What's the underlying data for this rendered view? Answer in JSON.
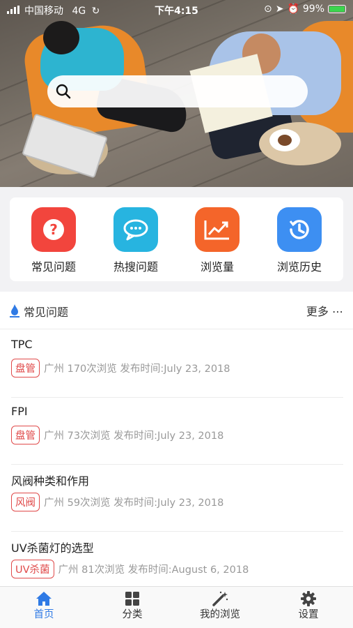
{
  "status_bar": {
    "carrier": "中国移动",
    "network": "4G",
    "time": "下午4:15",
    "battery": "99%",
    "battery_level": 0.99
  },
  "search": {
    "placeholder": ""
  },
  "quick_links": [
    {
      "label": "常见问题",
      "color": "#f2453d",
      "icon": "question-icon"
    },
    {
      "label": "热搜问题",
      "color": "#27b4e0",
      "icon": "chat-bubbles-icon"
    },
    {
      "label": "浏览量",
      "color": "#f4652a",
      "icon": "trend-chart-icon"
    },
    {
      "label": "浏览历史",
      "color": "#3d8ff2",
      "icon": "history-icon"
    }
  ],
  "section": {
    "title": "常见问题",
    "more": "更多 ⋯"
  },
  "articles": [
    {
      "title": "TPC",
      "tag": "盘管",
      "meta": "广州 170次浏览 发布时间:July 23, 2018"
    },
    {
      "title": "FPI",
      "tag": "盘管",
      "meta": "广州 73次浏览 发布时间:July 23, 2018"
    },
    {
      "title": "风阀种类和作用",
      "tag": "风阀",
      "meta": "广州 59次浏览 发布时间:July 23, 2018"
    },
    {
      "title": "UV杀菌灯的选型",
      "tag": "UV杀菌",
      "meta": "广州 81次浏览 发布时间:August 6, 2018"
    }
  ],
  "tabs": [
    {
      "label": "首页",
      "icon": "home-icon",
      "active": true
    },
    {
      "label": "分类",
      "icon": "grid-icon",
      "active": false
    },
    {
      "label": "我的浏览",
      "icon": "magic-wand-icon",
      "active": false
    },
    {
      "label": "设置",
      "icon": "gear-icon",
      "active": false
    }
  ],
  "colors": {
    "accent": "#2f7ae5",
    "tag": "#e04a4a"
  }
}
